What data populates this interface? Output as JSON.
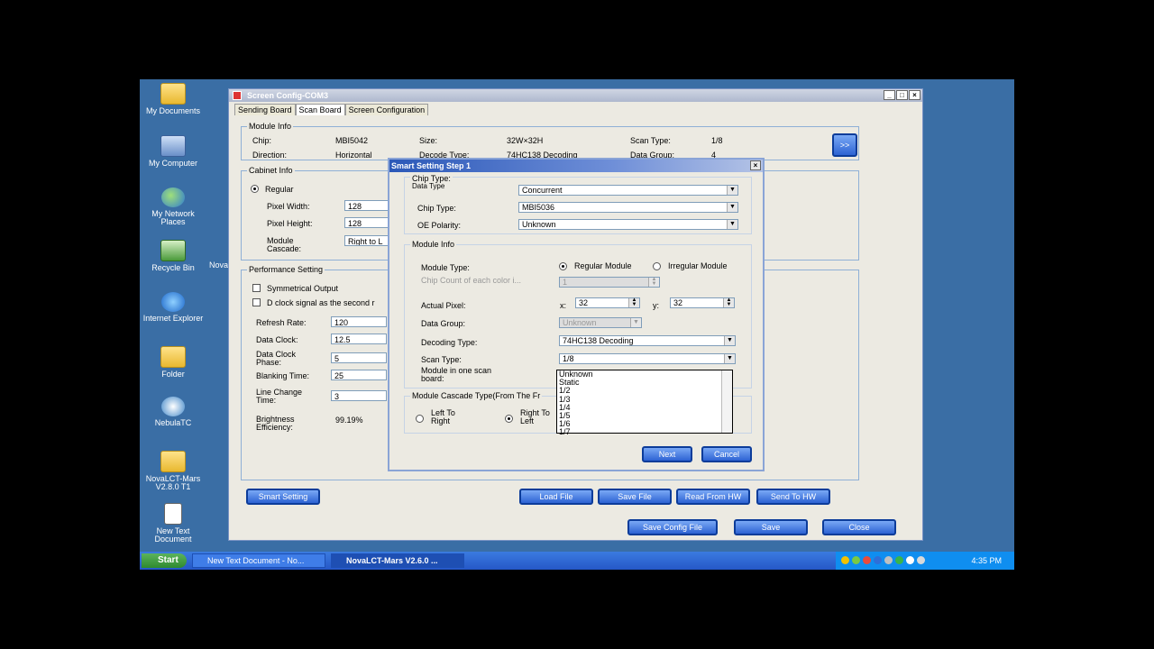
{
  "desktop_icons": [
    {
      "label": "My Documents",
      "icon": "folder-icon"
    },
    {
      "label": "My Computer",
      "icon": "computer-icon"
    },
    {
      "label": "My Network Places",
      "icon": "network-icon"
    },
    {
      "label": "Recycle Bin",
      "icon": "recycle-bin-icon"
    },
    {
      "label": "Internet Explorer",
      "icon": "ie-icon"
    },
    {
      "label": "Folder",
      "icon": "folder-icon"
    },
    {
      "label": "NebulaTC",
      "icon": "nebula-icon"
    },
    {
      "label": "NovaLCT-Mars V2.8.0 T1",
      "icon": "folder-icon"
    },
    {
      "label": "New Text Document",
      "icon": "text-document-icon"
    }
  ],
  "hidden_icon_label": "Nova",
  "window": {
    "title": "Screen Config-COM3",
    "controls": [
      "_",
      "□",
      "×"
    ],
    "tabs": [
      "Sending Board",
      "Scan Board",
      "Screen Configuration"
    ],
    "active_tab": "Scan Board",
    "module_info": {
      "legend": "Module Info",
      "chip_label": "Chip:",
      "chip_value": "MBI5042",
      "size_label": "Size:",
      "size_value": "32W×32H",
      "scan_type_label": "Scan Type:",
      "scan_type_value": "1/8",
      "direction_label": "Direction:",
      "direction_value": "Horizontal",
      "decode_type_label": "Decode Type:",
      "decode_type_value": "74HC138 Decoding",
      "data_group_label": "Data Group:",
      "data_group_value": "4",
      "more_button": ">>"
    },
    "cabinet_info": {
      "legend": "Cabinet Info",
      "regular_label": "Regular",
      "pixel_width_label": "Pixel Width:",
      "pixel_width_value": "128",
      "pixel_height_label": "Pixel Height:",
      "pixel_height_value": "128",
      "module_cascade_label": "Module Cascade:",
      "module_cascade_value": "Right to L"
    },
    "performance": {
      "legend": "Performance Setting",
      "symmetrical_output": "Symmetrical Output",
      "d_clock_signal": "D clock signal as the second r",
      "refresh_rate_label": "Refresh Rate:",
      "refresh_rate_value": "120",
      "data_clock_label": "Data Clock:",
      "data_clock_value": "12.5",
      "data_clock_phase_label": "Data Clock Phase:",
      "data_clock_phase_value": "5",
      "blanking_time_label": "Blanking Time:",
      "blanking_time_value": "25",
      "line_change_time_label": "Line Change Time:",
      "line_change_time_value": "3",
      "brightness_efficiency_label": "Brightness Efficiency:",
      "brightness_efficiency_value": "99.19%"
    },
    "buttons": {
      "smart_setting": "Smart Setting",
      "load_file": "Load File",
      "save_file": "Save File",
      "read_from_hw": "Read From HW",
      "send_to_hw": "Send To HW",
      "save_config_file": "Save Config File",
      "save": "Save",
      "close": "Close"
    }
  },
  "dialog": {
    "title": "Smart Setting Step 1",
    "chip_group": {
      "legend": "Chip Type:",
      "data_type_label": "Data Type",
      "data_type_value": "Concurrent",
      "chip_type_label": "Chip Type:",
      "chip_type_value": "MBI5036",
      "oe_polarity_label": "OE Polarity:",
      "oe_polarity_value": "Unknown"
    },
    "module_group": {
      "legend": "Module Info",
      "module_type_label": "Module Type:",
      "regular_module": "Regular Module",
      "irregular_module": "Irregular Module",
      "chip_count_label": "Chip Count of each color i...",
      "chip_count_value": "1",
      "actual_pixel_label": "Actual Pixel:",
      "x_label": "x:",
      "x_value": "32",
      "y_label": "y:",
      "y_value": "32",
      "data_group_label": "Data Group:",
      "data_group_value": "Unknown",
      "decoding_type_label": "Decoding Type:",
      "decoding_type_value": "74HC138 Decoding",
      "scan_type_label": "Scan Type:",
      "scan_type_value": "1/8",
      "module_in_one_label": "Module in one scan board:"
    },
    "scan_type_options": [
      "Unknown",
      "Static",
      "1/2",
      "1/3",
      "1/4",
      "1/5",
      "1/6",
      "1/7"
    ],
    "cascade_group": {
      "legend": "Module Cascade Type(From The Fr",
      "left_to_right": "Left To Right",
      "right_to_left": "Right To Left"
    },
    "next_button": "Next",
    "cancel_button": "Cancel",
    "close_glyph": "×"
  },
  "taskbar": {
    "start_label": "Start",
    "tasks": [
      "New Text Document - No...",
      "NovaLCT-Mars V2.6.0 ..."
    ],
    "clock": "4:35 PM"
  }
}
